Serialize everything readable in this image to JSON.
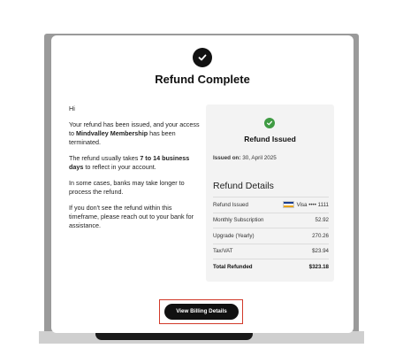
{
  "modal": {
    "title": "Refund Complete",
    "greeting": "Hi",
    "para1_a": "Your refund has been issued, and your access to ",
    "para1_product": "Mindvalley Membership",
    "para1_b": " has been terminated.",
    "para2_a": "The refund usually takes ",
    "para2_days": "7 to 14 business days",
    "para2_b": " to reflect in your account.",
    "para3": "In some cases, banks may take longer to process the refund.",
    "para4": "If you don't see the refund within this timeframe, please reach out to your bank for assistance."
  },
  "card": {
    "title": "Refund Issued",
    "issued_on_label": "Issued on:",
    "issued_on_date": "30, April 2025",
    "details_title": "Refund Details",
    "rows": [
      {
        "label": "Refund Issued",
        "value": "Visa •••• 1111"
      },
      {
        "label": "Monthly Subscription",
        "value": "52.92"
      },
      {
        "label": "Upgrade (Yearly)",
        "value": "270.26"
      },
      {
        "label": "Tax/VAT",
        "value": "$23.94"
      },
      {
        "label": "Total Refunded",
        "value": "$323.18"
      }
    ],
    "check_color": "#3f9b43"
  },
  "actions": {
    "view_billing_label": "View Billing Details",
    "highlight_color": "#d23a2a"
  },
  "icons": [
    "check-circle-icon",
    "check-circle-green-icon",
    "visa-card-icon"
  ]
}
